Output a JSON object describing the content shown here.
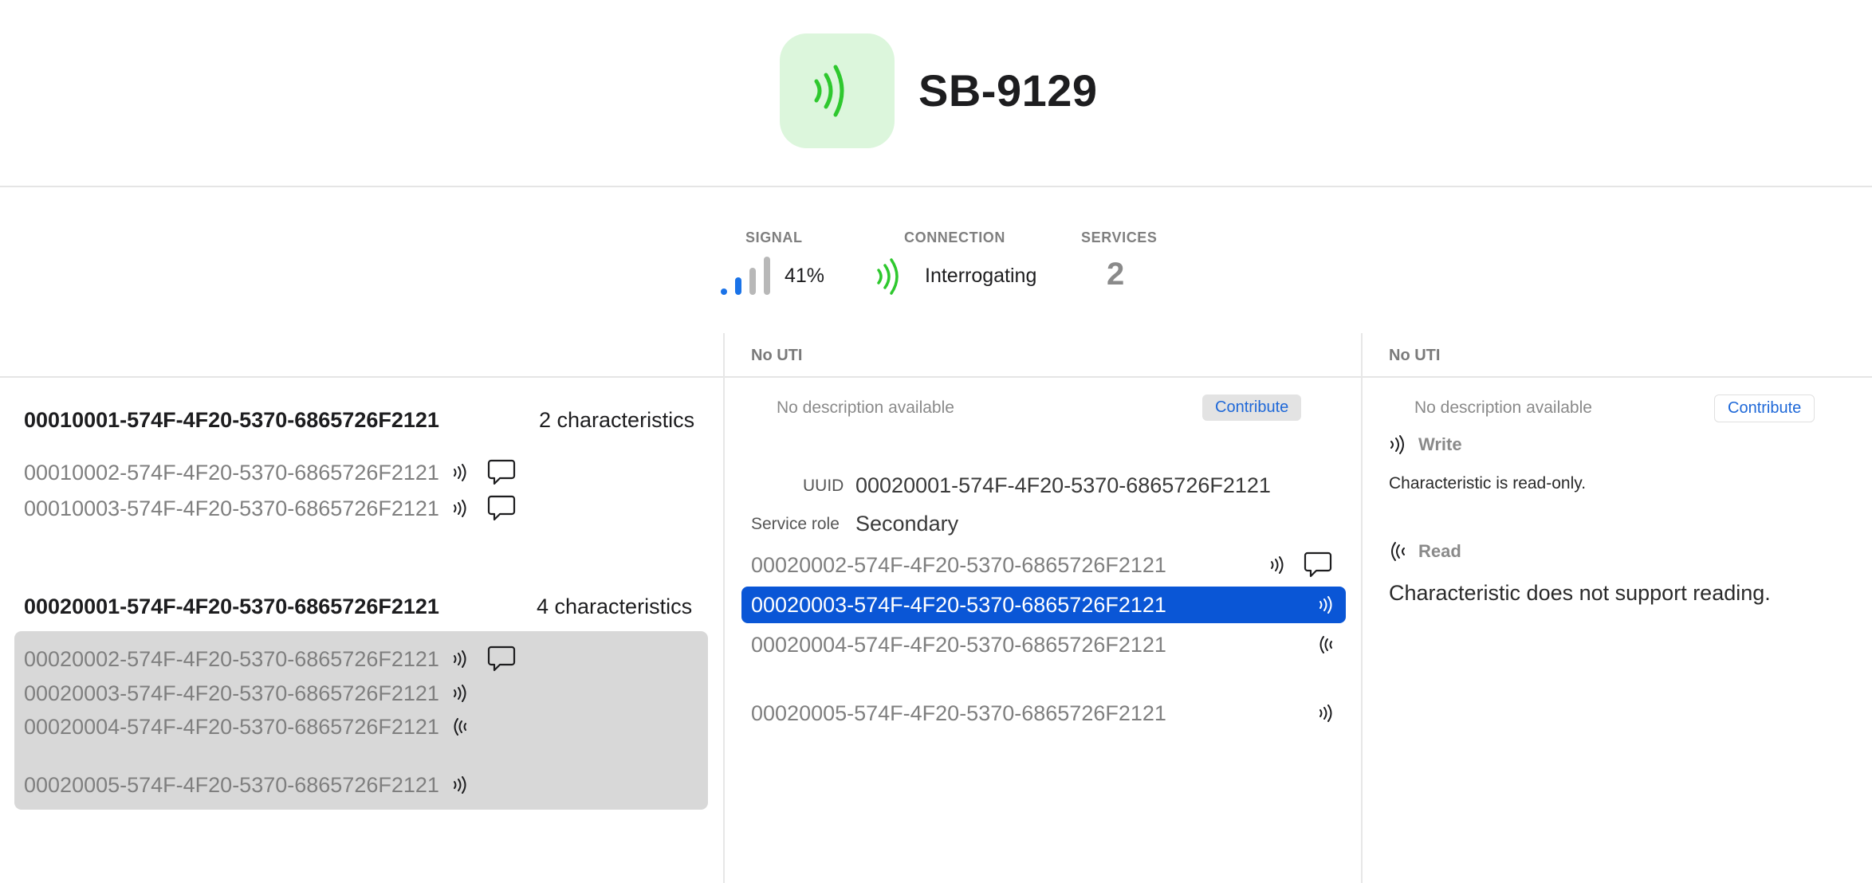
{
  "device": {
    "name": "SB-9129",
    "icon": "radio-waves-icon",
    "icon_color": "#2ec82e",
    "icon_bg": "#dcf6dc"
  },
  "stats": {
    "signal": {
      "label": "SIGNAL",
      "value": "41%",
      "level_fraction": 0.41
    },
    "connection": {
      "label": "CONNECTION",
      "value": "Interrogating"
    },
    "services": {
      "label": "SERVICES",
      "value": "2"
    }
  },
  "services": [
    {
      "uuid": "00010001-574F-4F20-5370-6865726F2121",
      "count": "2 characteristics",
      "characteristics": [
        {
          "uuid": "00010002-574F-4F20-5370-6865726F2121",
          "icons": [
            "write-waves-icon",
            "notify-bubble-icon"
          ]
        },
        {
          "uuid": "00010003-574F-4F20-5370-6865726F2121",
          "icons": [
            "write-waves-icon",
            "notify-bubble-icon"
          ]
        }
      ]
    },
    {
      "uuid": "00020001-574F-4F20-5370-6865726F2121",
      "count": "4 characteristics",
      "characteristics": [
        {
          "uuid": "00020002-574F-4F20-5370-6865726F2121",
          "icons": [
            "write-waves-icon",
            "notify-bubble-icon"
          ]
        },
        {
          "uuid": "00020003-574F-4F20-5370-6865726F2121",
          "icons": [
            "write-waves-icon"
          ]
        },
        {
          "uuid": "00020004-574F-4F20-5370-6865726F2121",
          "icons": [
            "read-waves-icon"
          ]
        },
        {
          "uuid": "00020005-574F-4F20-5370-6865726F2121",
          "icons": [
            "write-waves-icon"
          ]
        }
      ]
    }
  ],
  "service_detail": {
    "uti": "No UTI",
    "description": "No description available",
    "contribute": "Contribute",
    "uuid_label": "UUID",
    "uuid_value": "00020001-574F-4F20-5370-6865726F2121",
    "role_label": "Service role",
    "role_value": "Secondary",
    "characteristics": [
      {
        "uuid": "00020002-574F-4F20-5370-6865726F2121",
        "icons": [
          "write-waves-icon",
          "notify-bubble-icon"
        ]
      },
      {
        "uuid": "00020003-574F-4F20-5370-6865726F2121",
        "icons": [
          "write-waves-icon"
        ],
        "selected": true
      },
      {
        "uuid": "00020004-574F-4F20-5370-6865726F2121",
        "icons": [
          "read-waves-icon"
        ]
      },
      {
        "uuid": "00020005-574F-4F20-5370-6865726F2121",
        "icons": [
          "write-waves-icon"
        ]
      }
    ]
  },
  "characteristic_detail": {
    "uti": "No UTI",
    "description": "No description available",
    "contribute": "Contribute",
    "write_title": "Write",
    "write_text": "Characteristic is read-only.",
    "read_title": "Read",
    "read_text": "Characteristic does not support reading."
  },
  "colors": {
    "accent": "#0a56d6",
    "link": "#1e68d8",
    "signal_active": "#1a73e8",
    "signal_inactive": "#b8b8b8",
    "connection_icon": "#2ec82e",
    "selection_group": "#d8d8d8"
  }
}
